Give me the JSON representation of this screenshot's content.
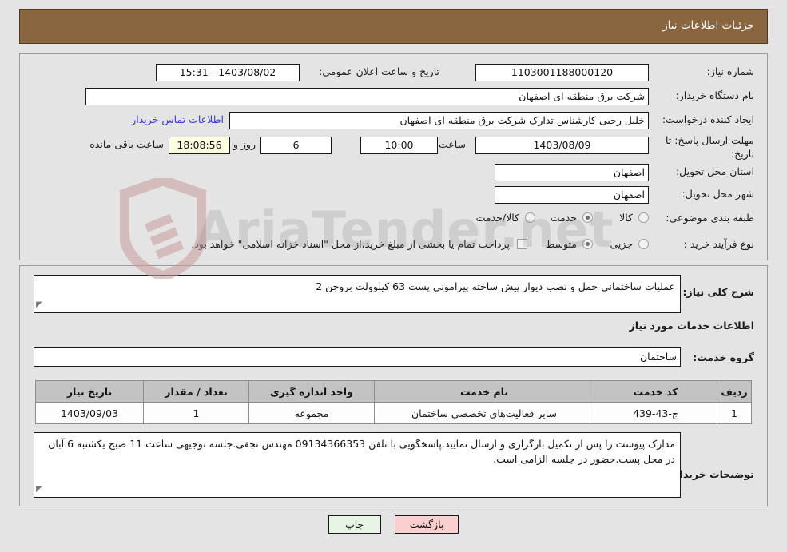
{
  "header": {
    "title": "جزئیات اطلاعات نیاز"
  },
  "watermark": {
    "text": "AriaTender.net",
    "shield_color": "#c89a9a"
  },
  "top_panel": {
    "fields": [
      {
        "label": "شماره نیاز:",
        "value": "1103001188000120"
      },
      {
        "label": "نام دستگاه خریدار:",
        "value": "شرکت برق منطقه ای اصفهان"
      },
      {
        "label": "ایجاد کننده درخواست:",
        "value": "خلیل رجبی کارشناس تدارک شرکت برق منطقه ای اصفهان"
      },
      {
        "label": "مهلت ارسال پاسخ: تا تاریخ:",
        "value": "1403/08/09"
      },
      {
        "label": "استان محل تحویل:",
        "value": "اصفهان"
      },
      {
        "label": "شهر محل تحویل:",
        "value": "اصفهان"
      }
    ],
    "announce": {
      "label": "تاریخ و ساعت اعلان عمومی:",
      "value": "1403/08/02 - 15:31"
    },
    "contact_link": "اطلاعات تماس خریدار",
    "deadline": {
      "hour_label": "ساعت",
      "hour_value": "10:00",
      "days_value": "6",
      "days_label": "روز و",
      "timer_value": "18:08:56",
      "timer_label": "ساعت باقی مانده"
    },
    "category": {
      "label": "طبقه بندی موضوعی:",
      "options": [
        {
          "label": "کالا",
          "selected": false
        },
        {
          "label": "خدمت",
          "selected": true
        },
        {
          "label": "کالا/خدمت",
          "selected": false
        }
      ]
    },
    "process": {
      "label": "نوع فرآیند خرید :",
      "options": [
        {
          "label": "جزیی",
          "selected": false
        },
        {
          "label": "متوسط",
          "selected": true
        }
      ],
      "checkbox_label": "پرداخت تمام یا بخشی از مبلغ خرید،از محل \"اسناد خزانه اسلامی\" خواهد بود.",
      "checkbox_checked": false
    }
  },
  "bottom_panel": {
    "summary_label": "شرح کلی نیاز:",
    "summary_value": "عملیات ساختمانی حمل و نصب دیوار پیش ساخته پیرامونی پست 63 کیلوولت بروجن 2",
    "section_title": "اطلاعات خدمات مورد نیاز",
    "service_group_label": "گروه خدمت:",
    "service_group_value": "ساختمان",
    "table": {
      "columns": [
        "ردیف",
        "کد خدمت",
        "نام خدمت",
        "واحد اندازه گیری",
        "تعداد / مقدار",
        "تاریخ نیاز"
      ],
      "rows": [
        [
          "1",
          "ج-43-439",
          "سایر فعالیت‌های تخصصی ساختمان",
          "مجموعه",
          "1",
          "1403/09/03"
        ]
      ]
    },
    "buyer_notes_label": "توضیحات خریدار:",
    "buyer_notes_value": "مدارک پیوست را پس از تکمیل بارگزاری و ارسال نمایید.پاسخگویی با تلفن 09134366353 مهندس نجفی.جلسه توجیهی ساعت 11 صبح یکشنبه 6 آبان در محل پست.حضور در جلسه الزامی است."
  },
  "footer": {
    "back_label": "بازگشت",
    "print_label": "چاپ"
  }
}
